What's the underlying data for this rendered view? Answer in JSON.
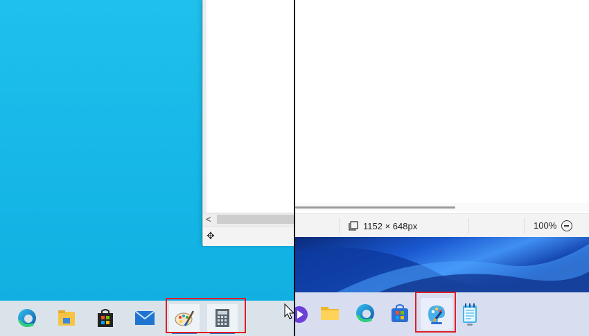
{
  "status_bar": {
    "dimensions": "1152 × 648px",
    "zoom": "100%"
  },
  "left_taskbar": {
    "items": [
      "edge-icon",
      "file-explorer-icon",
      "microsoft-store-icon",
      "mail-icon",
      "paint-icon",
      "calculator-icon"
    ],
    "highlighted": [
      "paint-icon",
      "calculator-icon"
    ]
  },
  "right_taskbar": {
    "items": [
      "media-icon",
      "file-explorer-icon",
      "edge-icon",
      "microsoft-store-icon",
      "paint-icon",
      "notepad-icon"
    ],
    "highlighted": [
      "paint-icon"
    ]
  },
  "colors": {
    "desktop_blue": "#14b6e6",
    "highlight_box": "#e01b24",
    "active_underline": "#3275c9"
  }
}
